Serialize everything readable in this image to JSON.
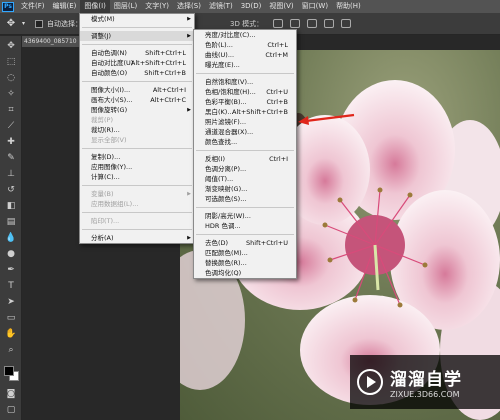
{
  "menubar": {
    "app_icon": "Ps",
    "items": [
      "文件(F)",
      "编辑(E)",
      "图像(I)",
      "图层(L)",
      "文字(Y)",
      "选择(S)",
      "滤镜(T)",
      "3D(D)",
      "视图(V)",
      "窗口(W)",
      "帮助(H)"
    ]
  },
  "options": {
    "auto_select_label": "自动选择：",
    "mode_label": "3D 模式："
  },
  "document": {
    "tab_title": "4369400_085710"
  },
  "image_menu": [
    {
      "label": "模式(M)",
      "shortcut": "",
      "submenu": true,
      "disabled": false
    },
    {
      "sep": true
    },
    {
      "label": "调整(J)",
      "shortcut": "",
      "submenu": true,
      "disabled": false,
      "highlight": true
    },
    {
      "sep": true
    },
    {
      "label": "自动色调(N)",
      "shortcut": "Shift+Ctrl+L",
      "submenu": false,
      "disabled": false
    },
    {
      "label": "自动对比度(U)",
      "shortcut": "Alt+Shift+Ctrl+L",
      "submenu": false,
      "disabled": false
    },
    {
      "label": "自动颜色(O)",
      "shortcut": "Shift+Ctrl+B",
      "submenu": false,
      "disabled": false
    },
    {
      "sep": true
    },
    {
      "label": "图像大小(I)...",
      "shortcut": "Alt+Ctrl+I",
      "submenu": false,
      "disabled": false
    },
    {
      "label": "画布大小(S)...",
      "shortcut": "Alt+Ctrl+C",
      "submenu": false,
      "disabled": false
    },
    {
      "label": "图像旋转(G)",
      "shortcut": "",
      "submenu": true,
      "disabled": false
    },
    {
      "label": "裁剪(P)",
      "shortcut": "",
      "submenu": false,
      "disabled": true
    },
    {
      "label": "裁切(R)...",
      "shortcut": "",
      "submenu": false,
      "disabled": false
    },
    {
      "label": "显示全部(V)",
      "shortcut": "",
      "submenu": false,
      "disabled": true
    },
    {
      "sep": true
    },
    {
      "label": "复制(D)...",
      "shortcut": "",
      "submenu": false,
      "disabled": false
    },
    {
      "label": "应用图像(Y)...",
      "shortcut": "",
      "submenu": false,
      "disabled": false
    },
    {
      "label": "计算(C)...",
      "shortcut": "",
      "submenu": false,
      "disabled": false
    },
    {
      "sep": true
    },
    {
      "label": "变量(B)",
      "shortcut": "",
      "submenu": true,
      "disabled": true
    },
    {
      "label": "应用数据组(L)...",
      "shortcut": "",
      "submenu": false,
      "disabled": true
    },
    {
      "sep": true
    },
    {
      "label": "陷印(T)...",
      "shortcut": "",
      "submenu": false,
      "disabled": true
    },
    {
      "sep": true
    },
    {
      "label": "分析(A)",
      "shortcut": "",
      "submenu": true,
      "disabled": false
    }
  ],
  "adjust_menu": [
    {
      "label": "亮度/对比度(C)...",
      "shortcut": ""
    },
    {
      "label": "色阶(L)...",
      "shortcut": "Ctrl+L"
    },
    {
      "label": "曲线(U)...",
      "shortcut": "Ctrl+M"
    },
    {
      "label": "曝光度(E)...",
      "shortcut": ""
    },
    {
      "sep": true
    },
    {
      "label": "自然饱和度(V)...",
      "shortcut": ""
    },
    {
      "label": "色相/饱和度(H)...",
      "shortcut": "Ctrl+U"
    },
    {
      "label": "色彩平衡(B)...",
      "shortcut": "Ctrl+B"
    },
    {
      "label": "黑白(K)...",
      "shortcut": "Alt+Shift+Ctrl+B"
    },
    {
      "label": "照片滤镜(F)...",
      "shortcut": ""
    },
    {
      "label": "通道混合器(X)...",
      "shortcut": ""
    },
    {
      "label": "颜色查找...",
      "shortcut": ""
    },
    {
      "sep": true
    },
    {
      "label": "反相(I)",
      "shortcut": "Ctrl+I"
    },
    {
      "label": "色调分离(P)...",
      "shortcut": ""
    },
    {
      "label": "阈值(T)...",
      "shortcut": ""
    },
    {
      "label": "渐变映射(G)...",
      "shortcut": ""
    },
    {
      "label": "可选颜色(S)...",
      "shortcut": ""
    },
    {
      "sep": true
    },
    {
      "label": "阴影/高光(W)...",
      "shortcut": ""
    },
    {
      "label": "HDR 色调...",
      "shortcut": ""
    },
    {
      "sep": true
    },
    {
      "label": "去色(D)",
      "shortcut": "Shift+Ctrl+U"
    },
    {
      "label": "匹配颜色(M)...",
      "shortcut": ""
    },
    {
      "label": "替换颜色(R)...",
      "shortcut": ""
    },
    {
      "label": "色调均化(Q)",
      "shortcut": ""
    }
  ],
  "watermark": {
    "name": "溜溜自学",
    "url": "ZIXUE.3D66.COM"
  },
  "colors": {
    "accent_red": "#e0261b",
    "menu_bg": "#f1f1f1",
    "ui_bg": "#3c3c3c"
  },
  "icons": [
    "move-icon",
    "marquee-icon",
    "lasso-icon",
    "magic-wand-icon",
    "crop-icon",
    "eyedropper-icon",
    "healing-icon",
    "brush-icon",
    "stamp-icon",
    "history-brush-icon",
    "eraser-icon",
    "gradient-icon",
    "blur-icon",
    "dodge-icon",
    "pen-icon",
    "type-icon",
    "path-select-icon",
    "shape-icon",
    "hand-icon",
    "zoom-icon"
  ]
}
